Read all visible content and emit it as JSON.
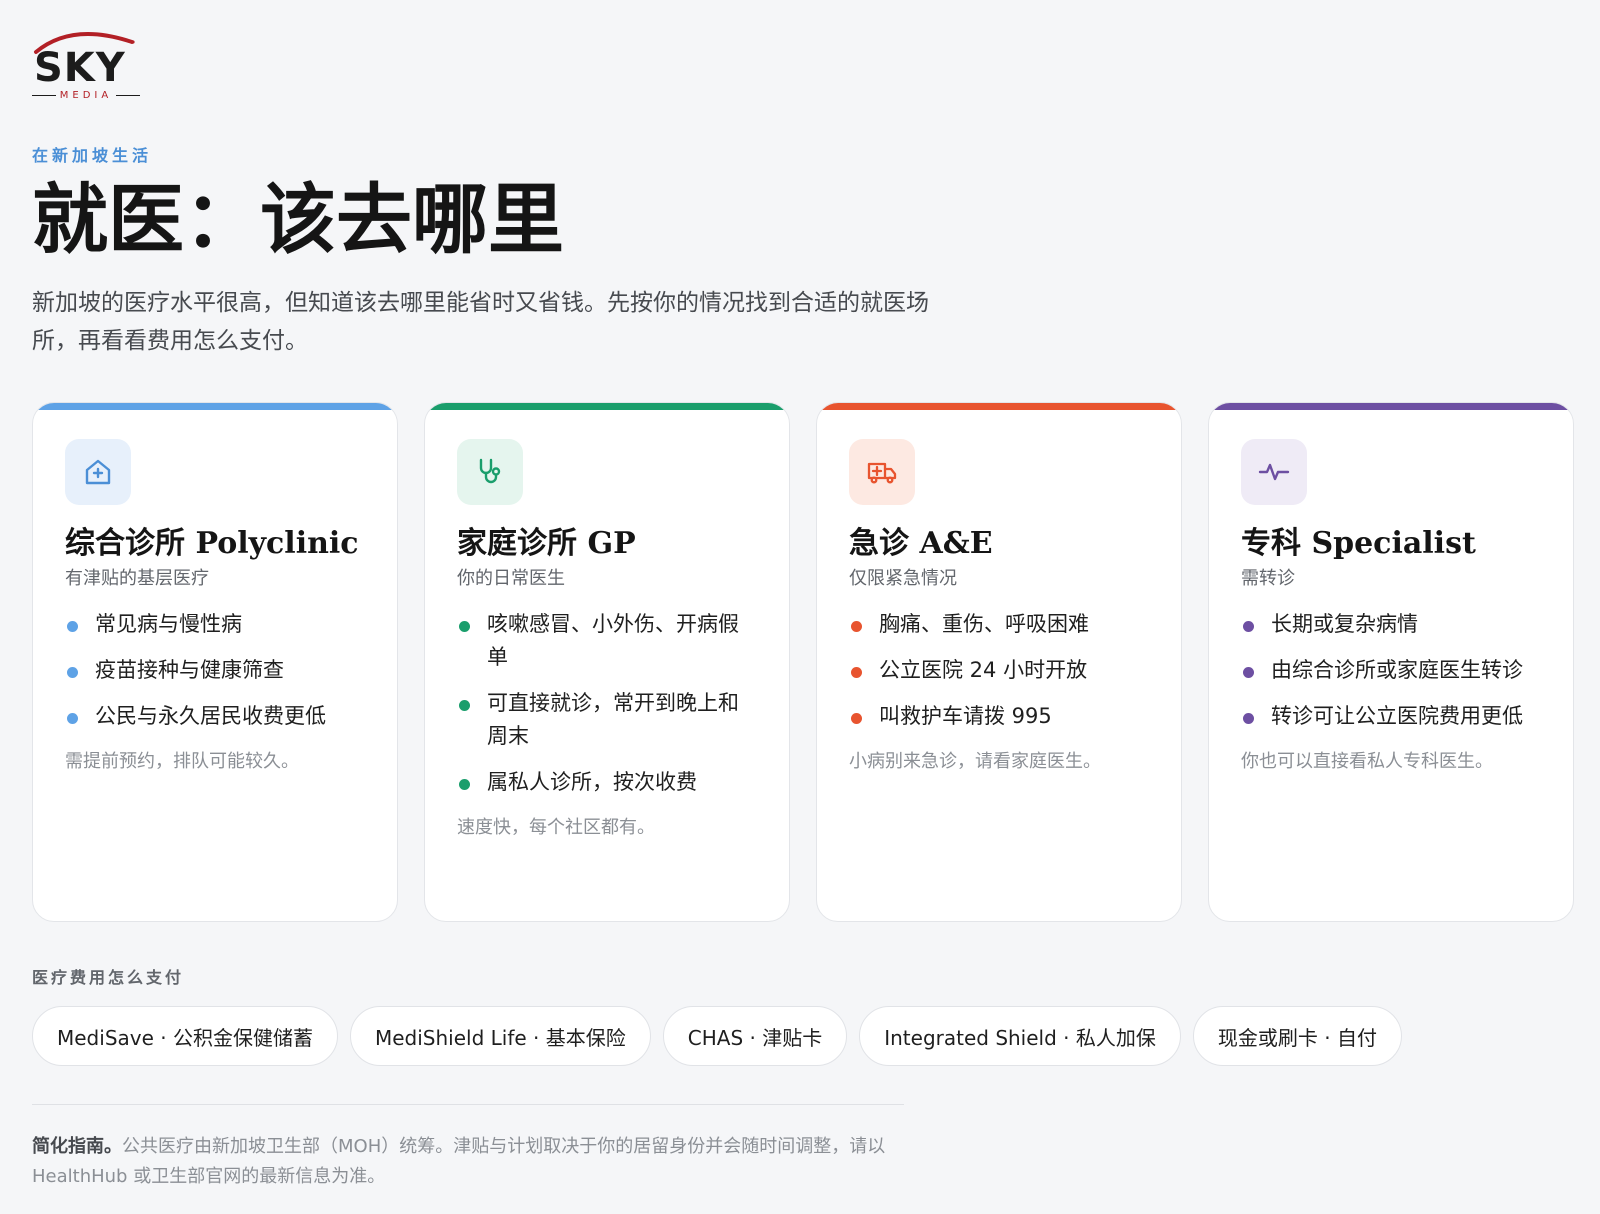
{
  "brand": {
    "logo_word": "SKY",
    "logo_sub": "MEDIA",
    "colors": {
      "arc": "#b32026",
      "word": "#1c1c1c"
    }
  },
  "header": {
    "eyebrow": "在新加坡生活",
    "title": "就医：该去哪里",
    "intro": "新加坡的医疗水平很高，但知道该去哪里能省时又省钱。先按你的情况找到合适的就医场所，再看看费用怎么支付。"
  },
  "cards": [
    {
      "accent": "#5ea2e6",
      "icon": "house-plus-icon",
      "title": "综合诊所 Polyclinic",
      "subtitle": "有津贴的基层医疗",
      "items": [
        "常见病与慢性病",
        "疫苗接种与健康筛查",
        "公民与永久居民收费更低"
      ],
      "note": "需提前预约，排队可能较久。"
    },
    {
      "accent": "#1a9e6c",
      "icon": "stethoscope-icon",
      "title": "家庭诊所 GP",
      "subtitle": "你的日常医生",
      "items": [
        "咳嗽感冒、小外伤、开病假单",
        "可直接就诊，常开到晚上和周末",
        "属私人诊所，按次收费"
      ],
      "note": "速度快，每个社区都有。"
    },
    {
      "accent": "#e8542f",
      "icon": "ambulance-icon",
      "title": "急诊 A&E",
      "subtitle": "仅限紧急情况",
      "items": [
        "胸痛、重伤、呼吸困难",
        "公立医院 24 小时开放",
        "叫救护车请拨 995"
      ],
      "note": "小病别来急诊，请看家庭医生。"
    },
    {
      "accent": "#6d4fa2",
      "icon": "pulse-icon",
      "title": "专科 Specialist",
      "subtitle": "需转诊",
      "items": [
        "长期或复杂病情",
        "由综合诊所或家庭医生转诊",
        "转诊可让公立医院费用更低"
      ],
      "note": "你也可以直接看私人专科医生。"
    }
  ],
  "payment": {
    "label": "医疗费用怎么支付",
    "chips": [
      "MediSave · 公积金保健储蓄",
      "MediShield Life · 基本保险",
      "CHAS · 津贴卡",
      "Integrated Shield · 私人加保",
      "现金或刷卡 · 自付"
    ]
  },
  "footer": {
    "lead": "简化指南。",
    "text": "公共医疗由新加坡卫生部（MOH）统筹。津贴与计划取决于你的居留身份并会随时间调整，请以 HealthHub 或卫生部官网的最新信息为准。"
  }
}
